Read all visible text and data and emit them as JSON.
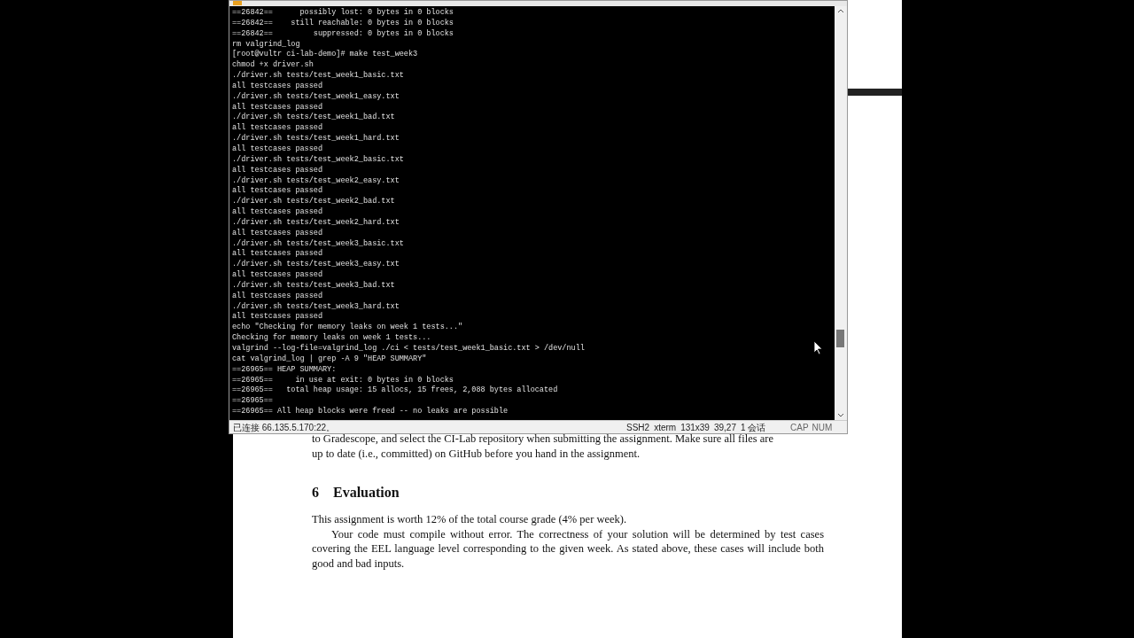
{
  "terminal": {
    "lines": [
      "==26842==      possibly lost: 0 bytes in 0 blocks",
      "==26842==    still reachable: 0 bytes in 0 blocks",
      "==26842==         suppressed: 0 bytes in 0 blocks",
      "rm valgrind_log",
      "[root@vultr ci-lab-demo]# make test_week3",
      "chmod +x driver.sh",
      "./driver.sh tests/test_week1_basic.txt",
      "all testcases passed",
      "./driver.sh tests/test_week1_easy.txt",
      "all testcases passed",
      "./driver.sh tests/test_week1_bad.txt",
      "all testcases passed",
      "./driver.sh tests/test_week1_hard.txt",
      "all testcases passed",
      "./driver.sh tests/test_week2_basic.txt",
      "all testcases passed",
      "./driver.sh tests/test_week2_easy.txt",
      "all testcases passed",
      "./driver.sh tests/test_week2_bad.txt",
      "all testcases passed",
      "./driver.sh tests/test_week2_hard.txt",
      "all testcases passed",
      "./driver.sh tests/test_week3_basic.txt",
      "all testcases passed",
      "./driver.sh tests/test_week3_easy.txt",
      "all testcases passed",
      "./driver.sh tests/test_week3_bad.txt",
      "all testcases passed",
      "./driver.sh tests/test_week3_hard.txt",
      "all testcases passed",
      "echo \"Checking for memory leaks on week 1 tests...\"",
      "Checking for memory leaks on week 1 tests...",
      "valgrind --log-file=valgrind_log ./ci < tests/test_week1_basic.txt > /dev/null",
      "cat valgrind_log | grep -A 9 \"HEAP SUMMARY\"",
      "==26965== HEAP SUMMARY:",
      "==26965==     in use at exit: 0 bytes in 0 blocks",
      "==26965==   total heap usage: 15 allocs, 15 frees, 2,088 bytes allocated",
      "==26965==",
      "==26965== All heap blocks were freed -- no leaks are possible"
    ],
    "status_bar": {
      "connection": "已连接 66.135.5.170:22。",
      "items": [
        "SSH2",
        "xterm",
        "131x39",
        "39,27",
        "1 会话"
      ],
      "keys": [
        "CAP",
        "NUM"
      ]
    }
  },
  "document": {
    "lines": [
      "to Gradescope, and select the CI-Lab repository when submitting the assignment. Make sure all files are",
      "up to date (i.e., committed) on GitHub before you hand in the assignment."
    ],
    "section": {
      "number": "6",
      "title": "Evaluation"
    },
    "paragraphs": [
      "This assignment is worth 12% of the total course grade (4% per week).",
      "Your code must compile without error. The correctness of your solution will be determined by test cases covering the EEL language level corresponding to the given week. As stated above, these cases will include both good and bad inputs."
    ]
  }
}
